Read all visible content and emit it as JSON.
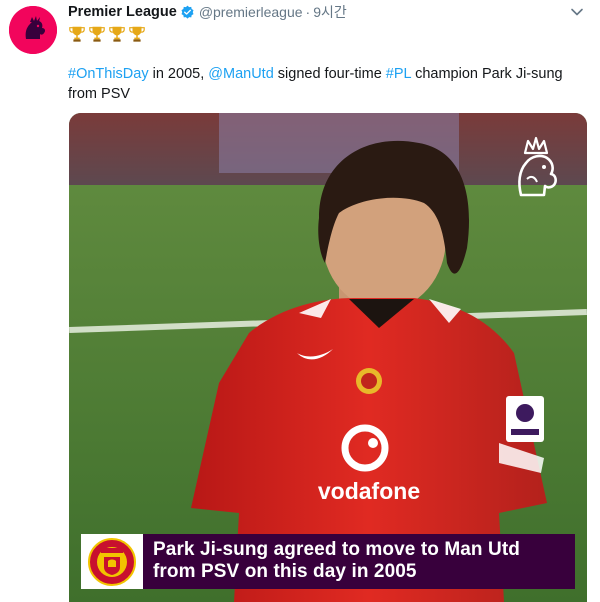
{
  "tweet": {
    "display_name": "Premier League",
    "handle": "@premierleague",
    "separator": "·",
    "time": "9시간",
    "trophies": [
      "trophy-icon",
      "trophy-icon",
      "trophy-icon",
      "trophy-icon"
    ],
    "text": {
      "hashtag_1": "#OnThisDay",
      "part_1": " in 2005, ",
      "mention": "@ManUtd",
      "part_2": " signed four-time ",
      "hashtag_2": "#PL",
      "part_3": " champion Park Ji-sung from PSV"
    }
  },
  "media": {
    "caption_line_1": "Park Ji-sung agreed to move to Man Utd",
    "caption_line_2": "from PSV on this day in 2005",
    "shirt_sponsor": "vodafone"
  },
  "colors": {
    "brand": "#38003c",
    "avatar_bg": "#f2055c",
    "link": "#1da1f2",
    "secondary_text": "#657786",
    "verified": "#1da1f2",
    "shirt": "#d9201c"
  }
}
